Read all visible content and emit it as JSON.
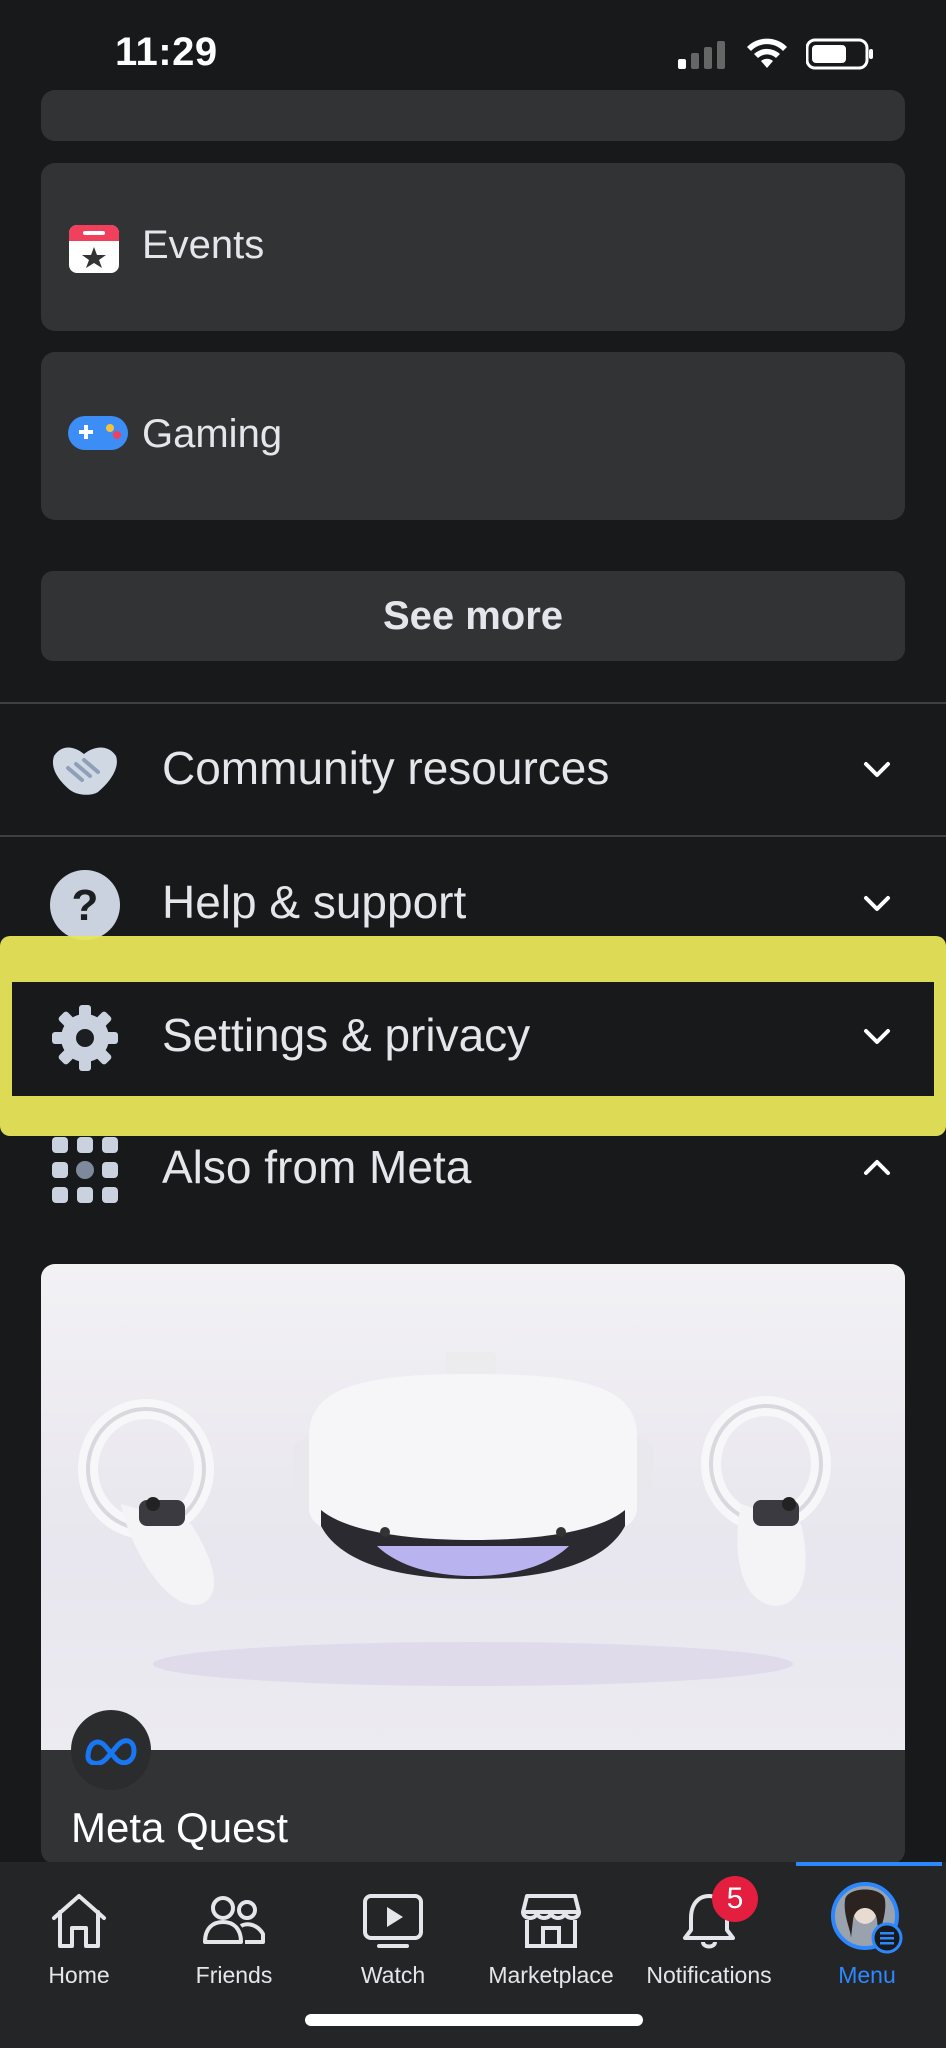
{
  "status_bar": {
    "time": "11:29"
  },
  "shortcuts": {
    "events_label": "Events",
    "gaming_label": "Gaming",
    "see_more_label": "See more"
  },
  "sections": {
    "community": "Community resources",
    "help": "Help & support",
    "settings": "Settings & privacy",
    "also_from_meta": "Also from Meta"
  },
  "promo": {
    "title": "Meta Quest"
  },
  "tabs": [
    {
      "label": "Home"
    },
    {
      "label": "Friends"
    },
    {
      "label": "Watch"
    },
    {
      "label": "Marketplace"
    },
    {
      "label": "Notifications"
    },
    {
      "label": "Menu"
    }
  ],
  "notifications_count": "5",
  "colors": {
    "accent": "#2d88ff",
    "highlight": "#e8e65a",
    "badge": "#e41e3f",
    "background": "#18191b",
    "card": "#323335"
  }
}
